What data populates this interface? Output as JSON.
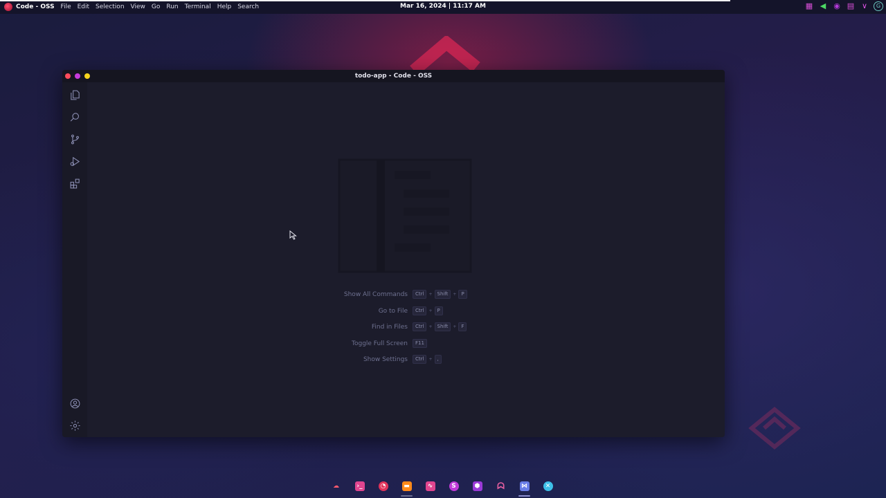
{
  "topbar": {
    "app_name": "Code - OSS",
    "menu": [
      "File",
      "Edit",
      "Selection",
      "View",
      "Go",
      "Run",
      "Terminal",
      "Help",
      "Search"
    ],
    "clock": "Mar 16, 2024 | 11:17 AM",
    "tray_icons": [
      "calendar-icon",
      "volume-icon",
      "cpu-icon",
      "screen-icon",
      "network-icon",
      "user-avatar"
    ],
    "avatar_letter": "G"
  },
  "window": {
    "title": "todo-app - Code - OSS",
    "activity_bar": [
      "explorer-icon",
      "search-icon",
      "source-control-icon",
      "run-debug-icon",
      "extensions-icon"
    ],
    "activity_bar_bottom": [
      "accounts-icon",
      "settings-gear-icon"
    ]
  },
  "editor": {
    "shortcuts": [
      {
        "label": "Show All Commands",
        "keys": [
          "Ctrl",
          "Shift",
          "P"
        ]
      },
      {
        "label": "Go to File",
        "keys": [
          "Ctrl",
          "P"
        ]
      },
      {
        "label": "Find in Files",
        "keys": [
          "Ctrl",
          "Shift",
          "F"
        ]
      },
      {
        "label": "Toggle Full Screen",
        "keys": [
          "F11"
        ]
      },
      {
        "label": "Show Settings",
        "keys": [
          "Ctrl",
          ","
        ]
      }
    ]
  },
  "dock": {
    "items": [
      {
        "icon": "cloud-icon",
        "color": "#ff5a6e"
      },
      {
        "icon": "terminal-icon",
        "color": "#e0458f"
      },
      {
        "icon": "browser-icon",
        "color": "#e0335a"
      },
      {
        "icon": "files-icon",
        "color": "#ff8a1a"
      },
      {
        "icon": "monitor-icon",
        "color": "#e0458f"
      },
      {
        "icon": "store-icon",
        "color": "#c13ad8"
      },
      {
        "icon": "settings-hex-icon",
        "color": "#9b3ad8"
      },
      {
        "icon": "ghost-icon",
        "color": "#e55fa0"
      },
      {
        "icon": "vscode-icon",
        "color": "#6a7ee8",
        "active": true
      },
      {
        "icon": "apps-icon",
        "color": "#3ec0e8"
      }
    ]
  },
  "colors": {
    "accent_red": "#ff4b5c",
    "window_bg": "#1d1d2c",
    "activity_icon": "#8d90b5"
  }
}
